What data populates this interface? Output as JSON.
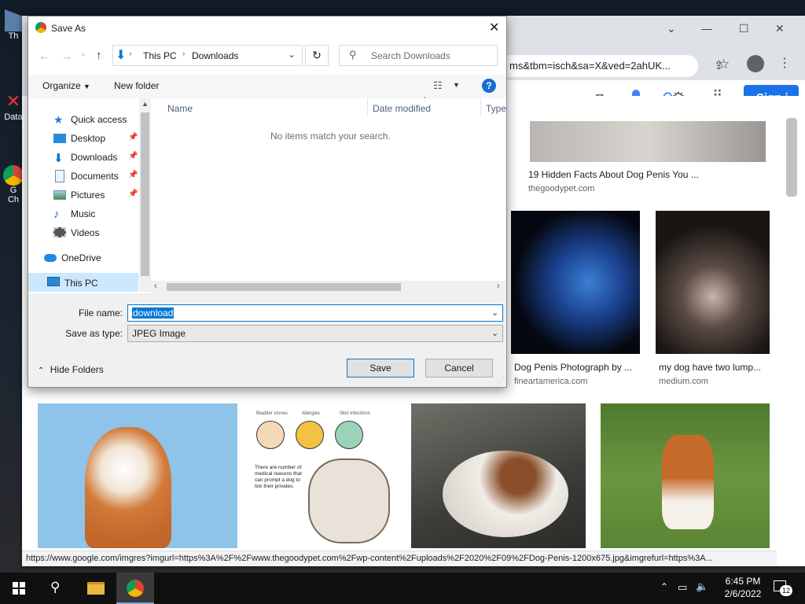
{
  "desktop": {
    "icons": [
      {
        "label": "Th"
      },
      {
        "label": "Data"
      },
      {
        "label": "G"
      },
      {
        "label": "Ch"
      }
    ]
  },
  "browser": {
    "address_url": "ms&tbm=isch&sa=X&ved=2ahUK...",
    "google_signin_label": "Sign i",
    "status_url": "https://www.google.com/imgres?imgurl=https%3A%2F%2Fwww.thegoodypet.com%2Fwp-content%2Fuploads%2F2020%2F09%2FDog-Penis-1200x675.jpg&imgrefurl=https%3A...",
    "results": [
      {
        "caption": "19 Hidden Facts About Dog Penis You ...",
        "source": "thegoodypet.com"
      },
      {
        "caption": "Dog Penis Photograph by ...",
        "source": "fineartamerica.com"
      },
      {
        "caption": "my dog have two lump...",
        "source": "medium.com"
      }
    ],
    "infographic_labels": [
      "Bladder stones",
      "Allergies",
      "Skin infections"
    ],
    "infographic_text": "There are number of medical reasons that can prompt a dog to lick their privates."
  },
  "dialog": {
    "title": "Save As",
    "breadcrumb": [
      "This PC",
      "Downloads"
    ],
    "search_placeholder": "Search Downloads",
    "organize_label": "Organize",
    "new_folder_label": "New folder",
    "nav_items": [
      {
        "label": "Quick access",
        "icon": "star-icon"
      },
      {
        "label": "Desktop",
        "icon": "desktop-icon",
        "pinned": true
      },
      {
        "label": "Downloads",
        "icon": "download-arrow-icon",
        "pinned": true
      },
      {
        "label": "Documents",
        "icon": "document-icon",
        "pinned": true
      },
      {
        "label": "Pictures",
        "icon": "pictures-icon",
        "pinned": true
      },
      {
        "label": "Music",
        "icon": "music-note-icon"
      },
      {
        "label": "Videos",
        "icon": "film-icon"
      },
      {
        "label": "OneDrive",
        "icon": "cloud-icon"
      },
      {
        "label": "This PC",
        "icon": "computer-icon"
      }
    ],
    "columns": [
      "Name",
      "Date modified",
      "Type"
    ],
    "empty_message": "No items match your search.",
    "file_name_label": "File name:",
    "file_name_value": "download",
    "save_type_label": "Save as type:",
    "save_type_value": "JPEG Image",
    "hide_folders_label": "Hide Folders",
    "save_label": "Save",
    "cancel_label": "Cancel"
  },
  "taskbar": {
    "time": "6:45 PM",
    "date": "2/6/2022",
    "notification_count": "12"
  },
  "colors": {
    "accent": "#0078d7",
    "google_blue": "#1a73e8",
    "selection": "#cce8ff"
  }
}
